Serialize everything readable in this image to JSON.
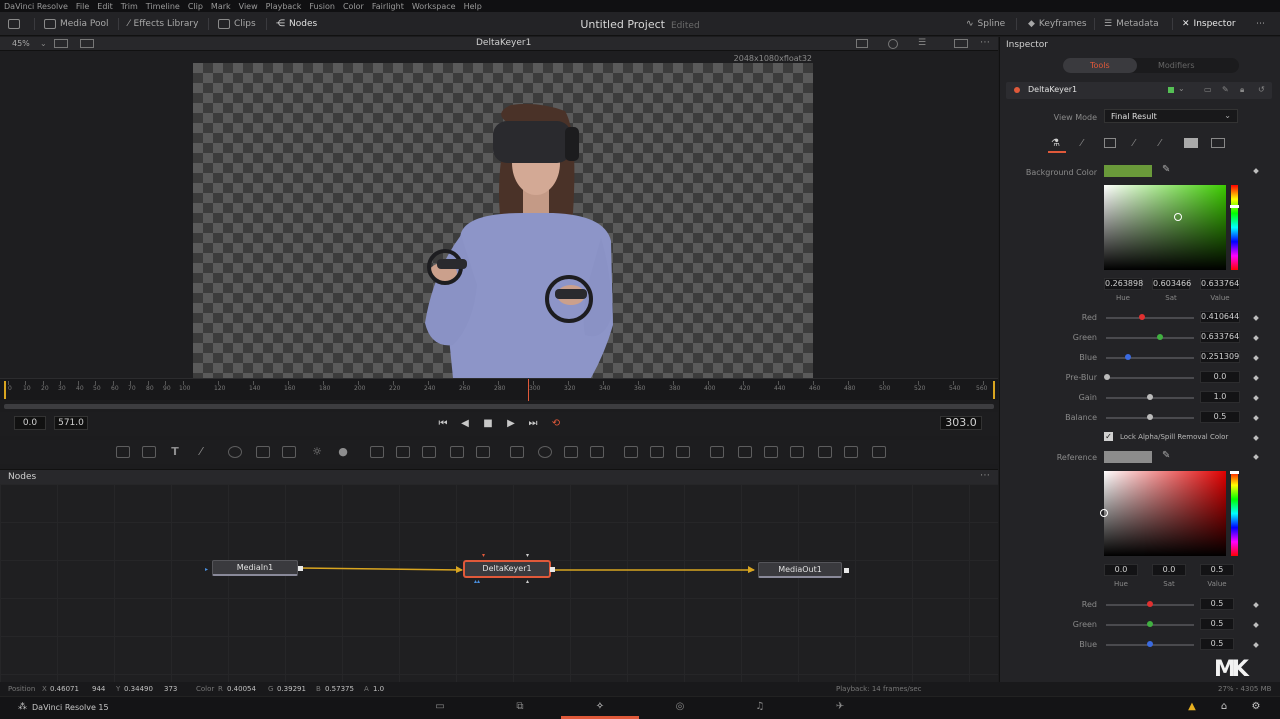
{
  "menu": [
    "DaVinci Resolve",
    "File",
    "Edit",
    "Trim",
    "Timeline",
    "Clip",
    "Mark",
    "View",
    "Playback",
    "Fusion",
    "Color",
    "Fairlight",
    "Workspace",
    "Help"
  ],
  "toolbar": {
    "media_pool": "Media Pool",
    "effects_library": "Effects Library",
    "clips": "Clips",
    "nodes": "Nodes",
    "project_title": "Untitled Project",
    "edited": "Edited",
    "spline": "Spline",
    "keyframes": "Keyframes",
    "metadata": "Metadata",
    "inspector": "Inspector"
  },
  "viewer": {
    "zoom": "45%",
    "title": "DeltaKeyer1",
    "resolution": "2048x1080xfloat32"
  },
  "ruler_ticks": [
    "0",
    "10",
    "20",
    "30",
    "40",
    "50",
    "60",
    "70",
    "80",
    "90",
    "100",
    "120",
    "140",
    "160",
    "180",
    "200",
    "220",
    "240",
    "260",
    "280",
    "300",
    "320",
    "340",
    "360",
    "380",
    "400",
    "420",
    "440",
    "460",
    "480",
    "500",
    "520",
    "540",
    "560"
  ],
  "transport": {
    "start": "0.0",
    "end": "571.0",
    "current": "303.0"
  },
  "nodes_panel": {
    "title": "Nodes",
    "nodes": [
      "MediaIn1",
      "DeltaKeyer1",
      "MediaOut1"
    ]
  },
  "status": {
    "position_label": "Position",
    "x_label": "X",
    "x_value": "0.46071",
    "x_px": "944",
    "y_label": "Y",
    "y_value": "0.34490",
    "y_px": "373",
    "color_label": "Color",
    "r_label": "R",
    "r_value": "0.40054",
    "g_label": "G",
    "g_value": "0.39291",
    "b_label": "B",
    "b_value": "0.57375",
    "a_label": "A",
    "a_value": "1.0",
    "playback": "Playback: 14 frames/sec",
    "memory": "27% - 4305 MB"
  },
  "pagenav": {
    "app_name": "DaVinci Resolve 15"
  },
  "inspector": {
    "title": "Inspector",
    "tab_tools": "Tools",
    "tab_modifiers": "Modifiers",
    "node_name": "DeltaKeyer1",
    "view_mode_label": "View Mode",
    "view_mode_value": "Final Result",
    "background_color_label": "Background Color",
    "background_color": "#6a9a3a",
    "hsv1": {
      "hue": "0.263898",
      "sat": "0.603466",
      "value": "0.633764"
    },
    "hsv_labels": {
      "hue": "Hue",
      "sat": "Sat",
      "value": "Value"
    },
    "red_label": "Red",
    "red_value": "0.410644",
    "green_label": "Green",
    "green_value": "0.633764",
    "blue_label": "Blue",
    "blue_value": "0.251309",
    "preblur_label": "Pre-Blur",
    "preblur_value": "0.0",
    "gain_label": "Gain",
    "gain_value": "1.0",
    "balance_label": "Balance",
    "balance_value": "0.5",
    "lock_label": "Lock Alpha/Spill Removal Color",
    "reference_label": "Reference",
    "reference_color": "#8c8c8c",
    "hsv2": {
      "hue": "0.0",
      "sat": "0.0",
      "value": "0.5"
    },
    "red2_value": "0.5",
    "green2_value": "0.5",
    "blue2_value": "0.5"
  },
  "colors": {
    "accent": "#e0593a",
    "link_yellow": "#d9a520",
    "highlight_green": "#55c055"
  },
  "watermark": "MK"
}
